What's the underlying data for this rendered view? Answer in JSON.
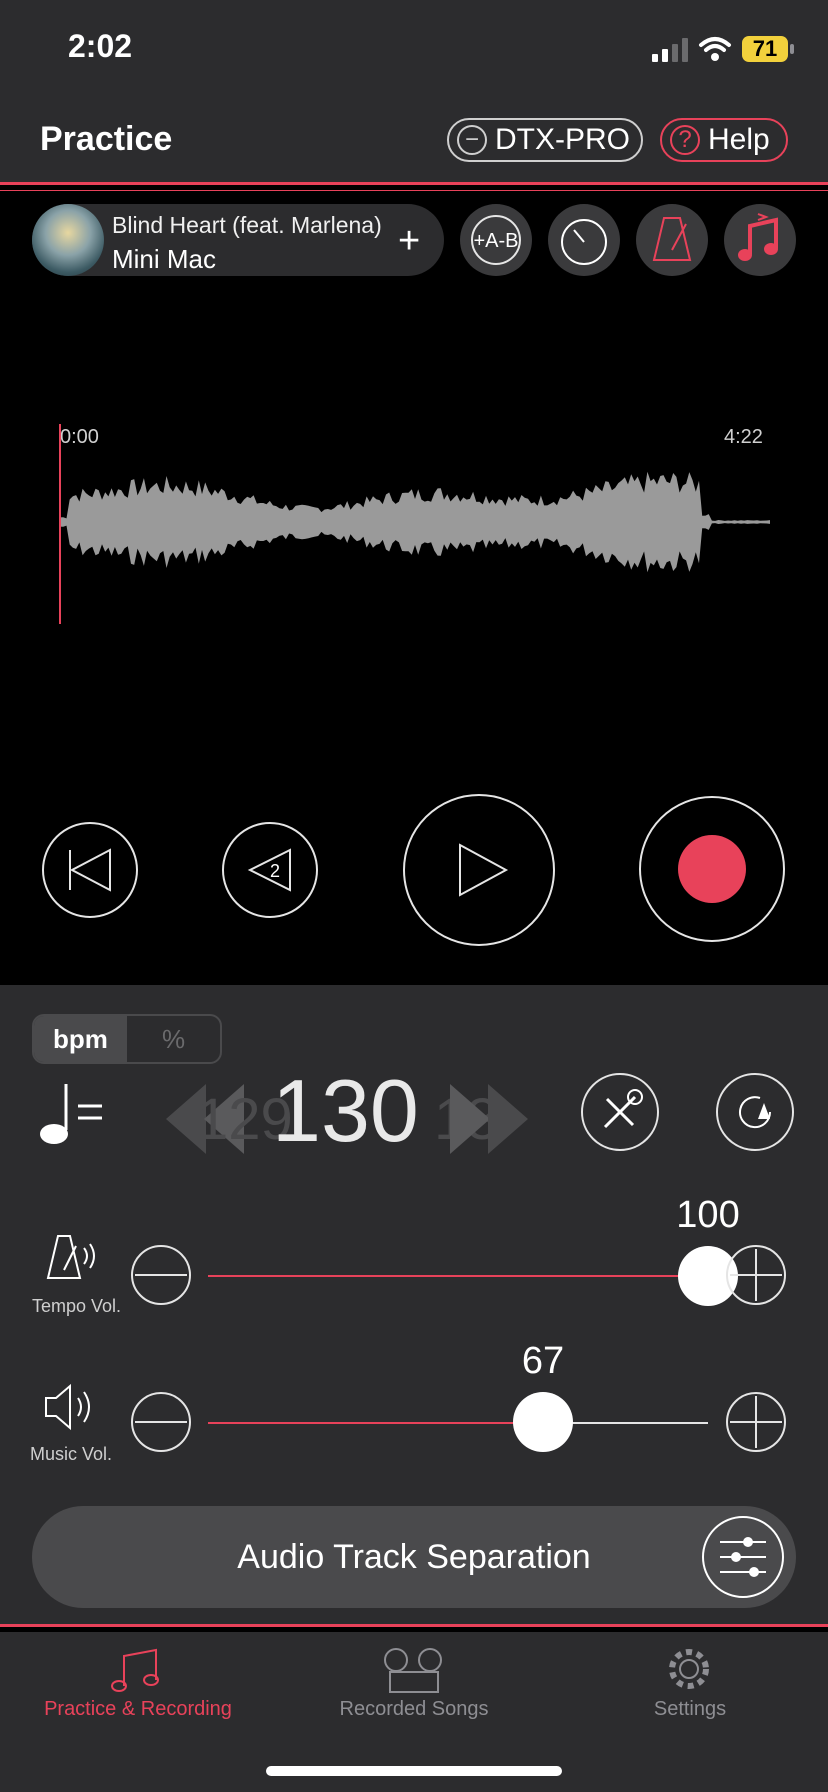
{
  "status_bar": {
    "time": "2:02",
    "battery": "71"
  },
  "header": {
    "title": "Practice",
    "dtx_label": "DTX-PRO",
    "help_label": "Help"
  },
  "song": {
    "title": "Blind Heart (feat. Marlena)",
    "artist": "Mini Mac"
  },
  "waveform": {
    "start_time": "0:00",
    "end_time": "4:22"
  },
  "transport": {
    "back_count": "2"
  },
  "tempo": {
    "mode_bpm": "bpm",
    "mode_percent": "%",
    "value": "130",
    "prev_ghost": "129",
    "next_ghost": "13"
  },
  "volumes": {
    "tempo": {
      "label": "Tempo Vol.",
      "value": "100",
      "level": 100
    },
    "music": {
      "label": "Music Vol.",
      "value": "67",
      "level": 67
    }
  },
  "ats": {
    "label": "Audio Track Separation"
  },
  "tabs": [
    {
      "label": "Practice & Recording",
      "active": true
    },
    {
      "label": "Recorded Songs",
      "active": false
    },
    {
      "label": "Settings",
      "active": false
    }
  ],
  "colors": {
    "accent": "#e8425a",
    "panel": "#2c2c2e",
    "background": "#000000"
  }
}
